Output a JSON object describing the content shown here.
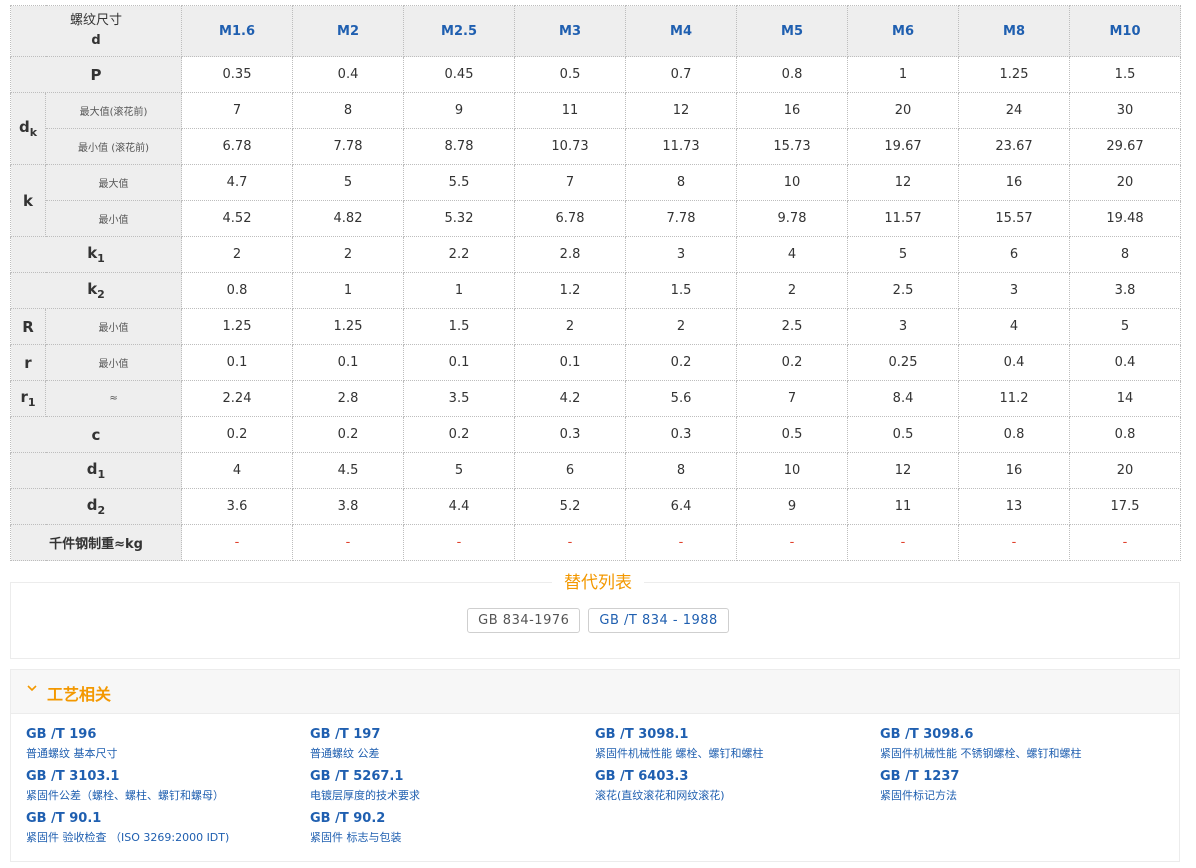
{
  "table": {
    "corner": {
      "line1": "螺纹尺寸",
      "line2": "d"
    },
    "sizes": [
      "M1.6",
      "M2",
      "M2.5",
      "M3",
      "M4",
      "M5",
      "M6",
      "M8",
      "M10"
    ],
    "rows": {
      "p": {
        "label": "P",
        "values": [
          "0.35",
          "0.4",
          "0.45",
          "0.5",
          "0.7",
          "0.8",
          "1",
          "1.25",
          "1.5"
        ]
      },
      "dk": {
        "label": "d",
        "label_sub": "k",
        "max_label": "最大值(滚花前)",
        "max": [
          "7",
          "8",
          "9",
          "11",
          "12",
          "16",
          "20",
          "24",
          "30"
        ],
        "min_label": "最小值 (滚花前)",
        "min": [
          "6.78",
          "7.78",
          "8.78",
          "10.73",
          "11.73",
          "15.73",
          "19.67",
          "23.67",
          "29.67"
        ]
      },
      "k": {
        "label": "k",
        "max_label": "最大值",
        "max": [
          "4.7",
          "5",
          "5.5",
          "7",
          "8",
          "10",
          "12",
          "16",
          "20"
        ],
        "min_label": "最小值",
        "min": [
          "4.52",
          "4.82",
          "5.32",
          "6.78",
          "7.78",
          "9.78",
          "11.57",
          "15.57",
          "19.48"
        ]
      },
      "k1": {
        "label": "k",
        "label_sub": "1",
        "values": [
          "2",
          "2",
          "2.2",
          "2.8",
          "3",
          "4",
          "5",
          "6",
          "8"
        ]
      },
      "k2": {
        "label": "k",
        "label_sub": "2",
        "values": [
          "0.8",
          "1",
          "1",
          "1.2",
          "1.5",
          "2",
          "2.5",
          "3",
          "3.8"
        ]
      },
      "R": {
        "label": "R",
        "sub_label": "最小值",
        "values": [
          "1.25",
          "1.25",
          "1.5",
          "2",
          "2",
          "2.5",
          "3",
          "4",
          "5"
        ]
      },
      "r": {
        "label": "r",
        "sub_label": "最小值",
        "values": [
          "0.1",
          "0.1",
          "0.1",
          "0.1",
          "0.2",
          "0.2",
          "0.25",
          "0.4",
          "0.4"
        ]
      },
      "r1": {
        "label": "r",
        "label_sub": "1",
        "sub_label": "≈",
        "values": [
          "2.24",
          "2.8",
          "3.5",
          "4.2",
          "5.6",
          "7",
          "8.4",
          "11.2",
          "14"
        ]
      },
      "c": {
        "label": "c",
        "values": [
          "0.2",
          "0.2",
          "0.2",
          "0.3",
          "0.3",
          "0.5",
          "0.5",
          "0.8",
          "0.8"
        ]
      },
      "d1": {
        "label": "d",
        "label_sub": "1",
        "values": [
          "4",
          "4.5",
          "5",
          "6",
          "8",
          "10",
          "12",
          "16",
          "20"
        ]
      },
      "d2": {
        "label": "d",
        "label_sub": "2",
        "values": [
          "3.6",
          "3.8",
          "4.4",
          "5.2",
          "6.4",
          "9",
          "11",
          "13",
          "17.5"
        ]
      },
      "weight": {
        "label": "千件钢制重≈kg",
        "values": [
          "-",
          "-",
          "-",
          "-",
          "-",
          "-",
          "-",
          "-",
          "-"
        ]
      }
    }
  },
  "alternatives": {
    "title": "替代列表",
    "tags": [
      "GB 834-1976",
      "GB /T 834 - 1988"
    ]
  },
  "craft": {
    "title": "工艺相关",
    "items": [
      {
        "code": "GB /T 196",
        "desc": "普通螺纹 基本尺寸"
      },
      {
        "code": "GB /T 197",
        "desc": "普通螺纹 公差"
      },
      {
        "code": "GB /T 3098.1",
        "desc": "紧固件机械性能 螺栓、螺钉和螺柱"
      },
      {
        "code": "GB /T 3098.6",
        "desc": "紧固件机械性能 不锈钢螺栓、螺钉和螺柱"
      },
      {
        "code": "GB /T 3103.1",
        "desc": "紧固件公差（螺栓、螺柱、螺钉和螺母）"
      },
      {
        "code": "GB /T 5267.1",
        "desc": "电镀层厚度的技术要求"
      },
      {
        "code": "GB /T 6403.3",
        "desc": "滚花(直纹滚花和网纹滚花)"
      },
      {
        "code": "GB /T 1237",
        "desc": "紧固件标记方法"
      },
      {
        "code": "GB /T 90.1",
        "desc": "紧固件 验收检查 （ISO 3269:2000 IDT)"
      },
      {
        "code": "GB /T 90.2",
        "desc": "紧固件 标志与包装"
      }
    ]
  },
  "colors": {
    "accent": "#f39800",
    "link": "#1f5fb0",
    "dash": "#e0412c"
  }
}
